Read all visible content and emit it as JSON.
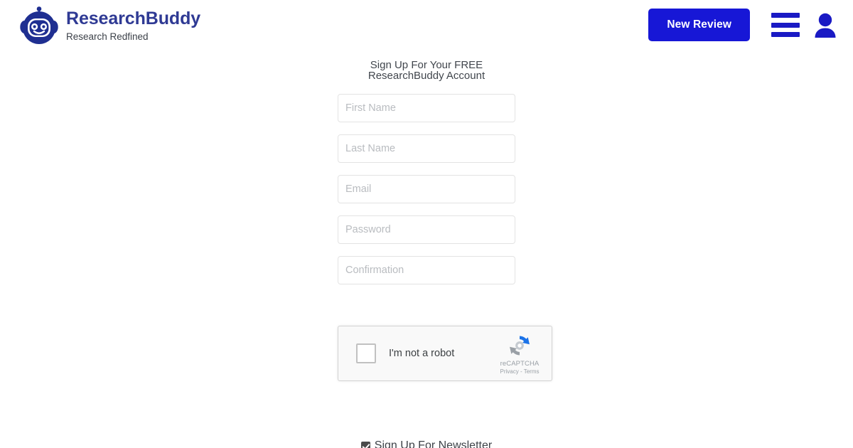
{
  "header": {
    "brand_name": "ResearchBuddy",
    "brand_tagline": "Research Redfined",
    "logo_icon": "robot-head-icon",
    "new_review_label": "New Review",
    "menu_icon": "hamburger-menu-icon",
    "account_icon": "user-avatar-icon",
    "brand_color": "#2f3a94",
    "accent_color": "#1717d6"
  },
  "signup": {
    "title_line1": "Sign Up For Your FREE",
    "title_line2": "ResearchBuddy Account",
    "fields": [
      {
        "name": "first-name",
        "placeholder": "First Name",
        "value": "",
        "type": "text"
      },
      {
        "name": "last-name",
        "placeholder": "Last Name",
        "value": "",
        "type": "text"
      },
      {
        "name": "email",
        "placeholder": "Email",
        "value": "",
        "type": "email"
      },
      {
        "name": "password",
        "placeholder": "Password",
        "value": "",
        "type": "password"
      },
      {
        "name": "confirmation",
        "placeholder": "Confirmation",
        "value": "",
        "type": "password"
      }
    ],
    "recaptcha": {
      "label": "I'm not a robot",
      "brand": "reCAPTCHA",
      "links": "Privacy - Terms",
      "logo_icon": "recaptcha-arrows-icon",
      "checked": false
    },
    "newsletter": {
      "label": "Sign Up For Newsletter",
      "checked": true
    }
  }
}
